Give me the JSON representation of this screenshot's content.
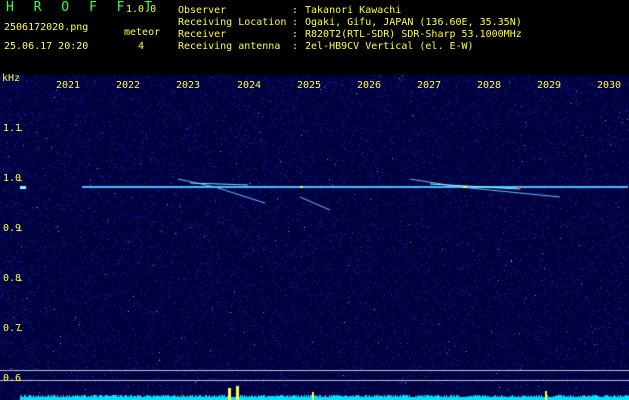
{
  "app": {
    "title": "H R O F F T",
    "version": "1.0.0",
    "filename": "2506172020.png",
    "datetime": "25.06.17 20:20",
    "meteor_label": "meteor",
    "meteor_count": "4"
  },
  "info": [
    {
      "label": "Observer",
      "sep": ":",
      "value": "Takanori Kawachi"
    },
    {
      "label": "Receiving Location",
      "sep": ":",
      "value": "Ogaki, Gifu, JAPAN (136.60E, 35.35N)"
    },
    {
      "label": "Receiver",
      "sep": ":",
      "value": "R820T2(RTL-SDR) SDR-Sharp 53.1000MHz"
    },
    {
      "label": "Receiving antenna",
      "sep": ":",
      "value": "2el-HB9CV Vertical (el. E-W)"
    }
  ],
  "axes": {
    "y_unit": "kHz",
    "x_ticks": [
      "2021",
      "2022",
      "2023",
      "2024",
      "2025",
      "2026",
      "2027",
      "2028",
      "2029",
      "2030"
    ],
    "y_ticks": [
      "1.1",
      "1.0",
      "0.9",
      "0.8",
      "0.7",
      "0.6"
    ]
  },
  "colors": {
    "label": "#ffff3c",
    "title": "#33ff44",
    "background": "#000040",
    "carrier": "#40c0ff",
    "noise_floor": "#00e0ff"
  }
}
